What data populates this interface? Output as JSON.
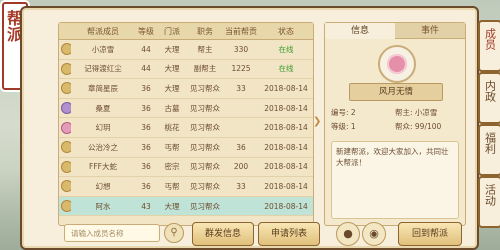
{
  "title": "帮派",
  "table": {
    "headers": [
      "帮派成员",
      "等级",
      "门派",
      "职务",
      "当前帮贡",
      "状态"
    ],
    "rows": [
      {
        "name": "小凉雪",
        "level": "44",
        "school": "大理",
        "position": "帮主",
        "contrib": "330",
        "status": "在线",
        "icon": "gold"
      },
      {
        "name": "记得渡红尘",
        "level": "44",
        "school": "大理",
        "position": "副帮主",
        "contrib": "1225",
        "status": "在线",
        "icon": "gold"
      },
      {
        "name": "章简星辰",
        "level": "36",
        "school": "大理",
        "position": "见习帮众",
        "contrib": "33",
        "status": "2018-08-14",
        "icon": "gold"
      },
      {
        "name": "桑夏",
        "level": "36",
        "school": "古墓",
        "position": "见习帮众",
        "contrib": "",
        "status": "2018-08-14",
        "icon": "purple"
      },
      {
        "name": "幻玥",
        "level": "36",
        "school": "桃花",
        "position": "见习帮众",
        "contrib": "",
        "status": "2018-08-14",
        "icon": "pink"
      },
      {
        "name": "公治冷之",
        "level": "36",
        "school": "丐帮",
        "position": "见习帮众",
        "contrib": "36",
        "status": "2018-08-14",
        "icon": "gold"
      },
      {
        "name": "FFF大蛇",
        "level": "36",
        "school": "密宗",
        "position": "见习帮众",
        "contrib": "200",
        "status": "2018-08-14",
        "icon": "gold"
      },
      {
        "name": "幻想",
        "level": "36",
        "school": "丐帮",
        "position": "见习帮众",
        "contrib": "33",
        "status": "2018-08-14",
        "icon": "gold"
      },
      {
        "name": "阿水",
        "level": "43",
        "school": "大理",
        "position": "见习帮众",
        "contrib": "",
        "status": "2018-08-14",
        "icon": "gold"
      }
    ]
  },
  "search": {
    "placeholder": "请输入成员名称"
  },
  "buttons": {
    "mass_message": "群发信息",
    "apply_list": "申请列表",
    "back": "回到帮派"
  },
  "panel": {
    "tabs": [
      "信息",
      "事件"
    ],
    "guild_name": "风月无情",
    "id_label": "编号: 2",
    "leader_label": "帮主: 小凉雪",
    "level_label": "等级: 1",
    "members_label": "帮众: 99/100",
    "notice": "新建帮派，欢迎大家加入，共同壮大帮派！"
  },
  "side_tabs": [
    "成员",
    "内政",
    "福利",
    "活动"
  ]
}
